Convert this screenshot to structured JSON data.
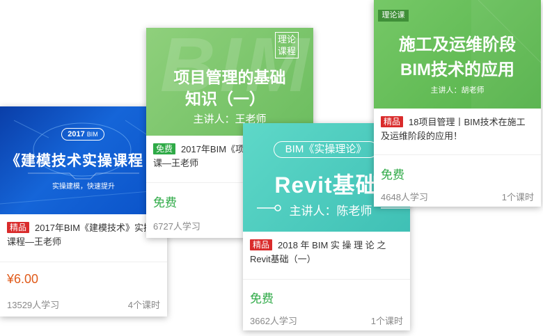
{
  "colors": {
    "tag_premium": "#d92b2b",
    "tag_free": "#2faa47",
    "price_paid": "#e05a1a",
    "price_free": "#2faa47"
  },
  "cards": [
    {
      "cover": {
        "year_badge": "2017",
        "year_badge_suffix": "BIM",
        "title": "《建模技术实操课程",
        "subtitle": "实操建模，快速提升"
      },
      "tag": "精品",
      "title": "2017年BIM《建模技术》实操课程—王老师",
      "price": "¥6.00",
      "students": "13529人学习",
      "lessons": "4个课时"
    },
    {
      "cover": {
        "badge": "理论课程",
        "watermark": "BIM",
        "title_line1": "项目管理的基础",
        "title_line2": "知识（一）",
        "teacher": "主讲人：王老师"
      },
      "tag": "免费",
      "title": "2017年BIM《项目管理》理论课—王老师",
      "price": "免费",
      "students": "6727人学习",
      "lessons": ""
    },
    {
      "cover": {
        "top_text": "BIM《实操理论》",
        "title": "Revit基础",
        "teacher": "主讲人：陈老师"
      },
      "tag": "精品",
      "title": "2018 年 BIM 实 操 理 论 之 Revit基础（一）",
      "price": "免费",
      "students": "3662人学习",
      "lessons": "1个课时"
    },
    {
      "cover": {
        "badge": "理论课",
        "title_line1": "施工及运维阶段",
        "title_line2": "BIM技术的应用",
        "teacher": "主讲人：胡老师"
      },
      "tag": "精品",
      "title": "18项目管理丨BIM技术在施工及运维阶段的应用！",
      "price": "免费",
      "students": "4648人学习",
      "lessons": "1个课时"
    }
  ]
}
